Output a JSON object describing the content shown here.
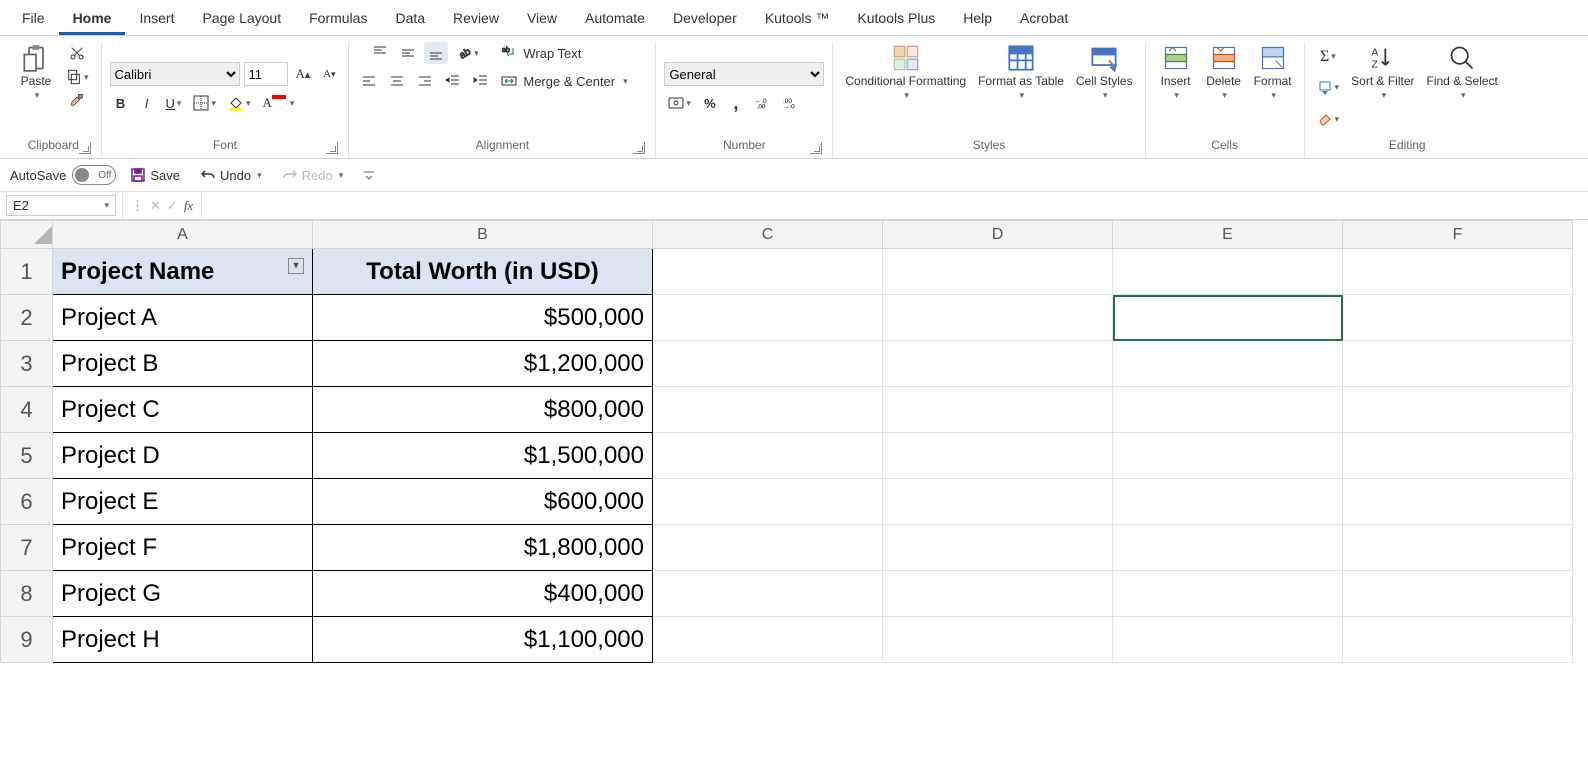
{
  "tabs": [
    "File",
    "Home",
    "Insert",
    "Page Layout",
    "Formulas",
    "Data",
    "Review",
    "View",
    "Automate",
    "Developer",
    "Kutools ™",
    "Kutools Plus",
    "Help",
    "Acrobat"
  ],
  "activeTab": "Home",
  "ribbon": {
    "clipboard": {
      "paste": "Paste",
      "label": "Clipboard"
    },
    "font": {
      "name": "Calibri",
      "size": "11",
      "label": "Font"
    },
    "alignment": {
      "wrap": "Wrap Text",
      "merge": "Merge & Center",
      "label": "Alignment"
    },
    "number": {
      "format": "General",
      "label": "Number"
    },
    "styles": {
      "cond": "Conditional Formatting",
      "table": "Format as Table",
      "cell": "Cell Styles",
      "label": "Styles"
    },
    "cells": {
      "insert": "Insert",
      "delete": "Delete",
      "format": "Format",
      "label": "Cells"
    },
    "editing": {
      "sort": "Sort & Filter",
      "find": "Find & Select",
      "label": "Editing"
    }
  },
  "qat": {
    "autosave": "AutoSave",
    "off": "Off",
    "save": "Save",
    "undo": "Undo",
    "redo": "Redo"
  },
  "namebox": "E2",
  "columns": [
    "A",
    "B",
    "C",
    "D",
    "E",
    "F"
  ],
  "sheet": {
    "headers": [
      "Project Name",
      "Total Worth (in USD)"
    ],
    "rows": [
      {
        "name": "Project A",
        "worth": "$500,000"
      },
      {
        "name": "Project B",
        "worth": "$1,200,000"
      },
      {
        "name": "Project C",
        "worth": "$800,000"
      },
      {
        "name": "Project D",
        "worth": "$1,500,000"
      },
      {
        "name": "Project E",
        "worth": "$600,000"
      },
      {
        "name": "Project F",
        "worth": "$1,800,000"
      },
      {
        "name": "Project G",
        "worth": "$400,000"
      },
      {
        "name": "Project H",
        "worth": "$1,100,000"
      }
    ]
  },
  "selectedCell": "E2"
}
